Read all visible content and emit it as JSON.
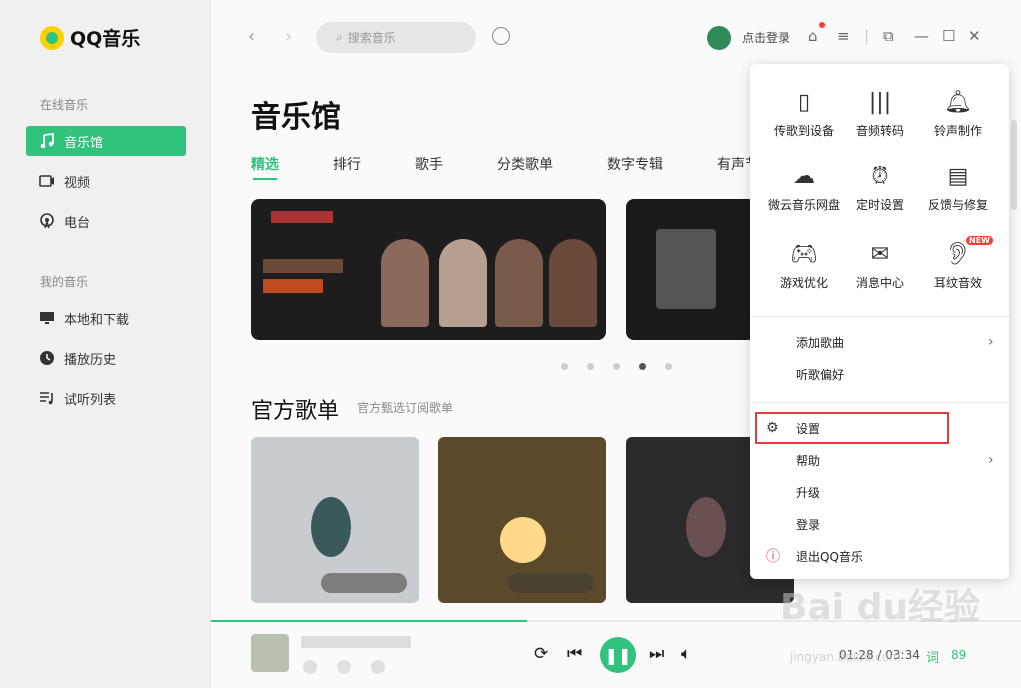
{
  "app": {
    "name": "QQ音乐"
  },
  "sidebar": {
    "sections": [
      {
        "label": "在线音乐",
        "items": [
          {
            "label": "音乐馆",
            "icon": "music-note-icon",
            "active": true
          },
          {
            "label": "视频",
            "icon": "video-icon",
            "active": false
          },
          {
            "label": "电台",
            "icon": "radio-icon",
            "active": false
          }
        ]
      },
      {
        "label": "我的音乐",
        "items": [
          {
            "label": "本地和下载",
            "icon": "monitor-icon",
            "active": false
          },
          {
            "label": "播放历史",
            "icon": "clock-icon",
            "active": false
          },
          {
            "label": "试听列表",
            "icon": "playlist-icon",
            "active": false
          }
        ]
      }
    ]
  },
  "topbar": {
    "search_placeholder": "搜索音乐",
    "login_label": "点击登录"
  },
  "main": {
    "title": "音乐馆",
    "tabs": [
      {
        "label": "精选",
        "active": true
      },
      {
        "label": "排行",
        "active": false
      },
      {
        "label": "歌手",
        "active": false
      },
      {
        "label": "分类歌单",
        "active": false
      },
      {
        "label": "数字专辑",
        "active": false
      },
      {
        "label": "有声节",
        "active": false
      }
    ],
    "carousel_active_index": 3,
    "carousel_count": 5,
    "section_title": "官方歌单",
    "section_subtitle": "官方甄选订阅歌单"
  },
  "menu": {
    "tiles": [
      {
        "label": "传歌到设备",
        "icon": "phone-icon"
      },
      {
        "label": "音频转码",
        "icon": "waveform-icon"
      },
      {
        "label": "铃声制作",
        "icon": "bell-icon"
      },
      {
        "label": "微云音乐网盘",
        "icon": "cloud-icon"
      },
      {
        "label": "定时设置",
        "icon": "alarm-clock-icon"
      },
      {
        "label": "反馈与修复",
        "icon": "feedback-icon"
      },
      {
        "label": "游戏优化",
        "icon": "gamepad-icon"
      },
      {
        "label": "消息中心",
        "icon": "mail-icon"
      },
      {
        "label": "耳纹音效",
        "icon": "ear-icon",
        "badge": "NEW"
      }
    ],
    "items": [
      {
        "label": "添加歌曲",
        "has_submenu": true
      },
      {
        "label": "听歌偏好",
        "has_submenu": false
      },
      {
        "label": "设置",
        "has_submenu": false,
        "icon": "gear-icon",
        "highlighted": true
      },
      {
        "label": "帮助",
        "has_submenu": true
      },
      {
        "label": "升级",
        "has_submenu": false
      },
      {
        "label": "登录",
        "has_submenu": false
      },
      {
        "label": "退出QQ音乐",
        "has_submenu": false,
        "icon": "exit-icon"
      }
    ]
  },
  "player": {
    "time": "01:28 / 03:34",
    "lyric_label": "词",
    "count": "89",
    "progress": 0.39
  },
  "watermark": {
    "text": "Bai du经验",
    "sub": "jingyan.baidu.com"
  },
  "colors": {
    "accent": "#31c27c",
    "highlight_border": "#e23c3c",
    "badge": "#ff3b30"
  }
}
